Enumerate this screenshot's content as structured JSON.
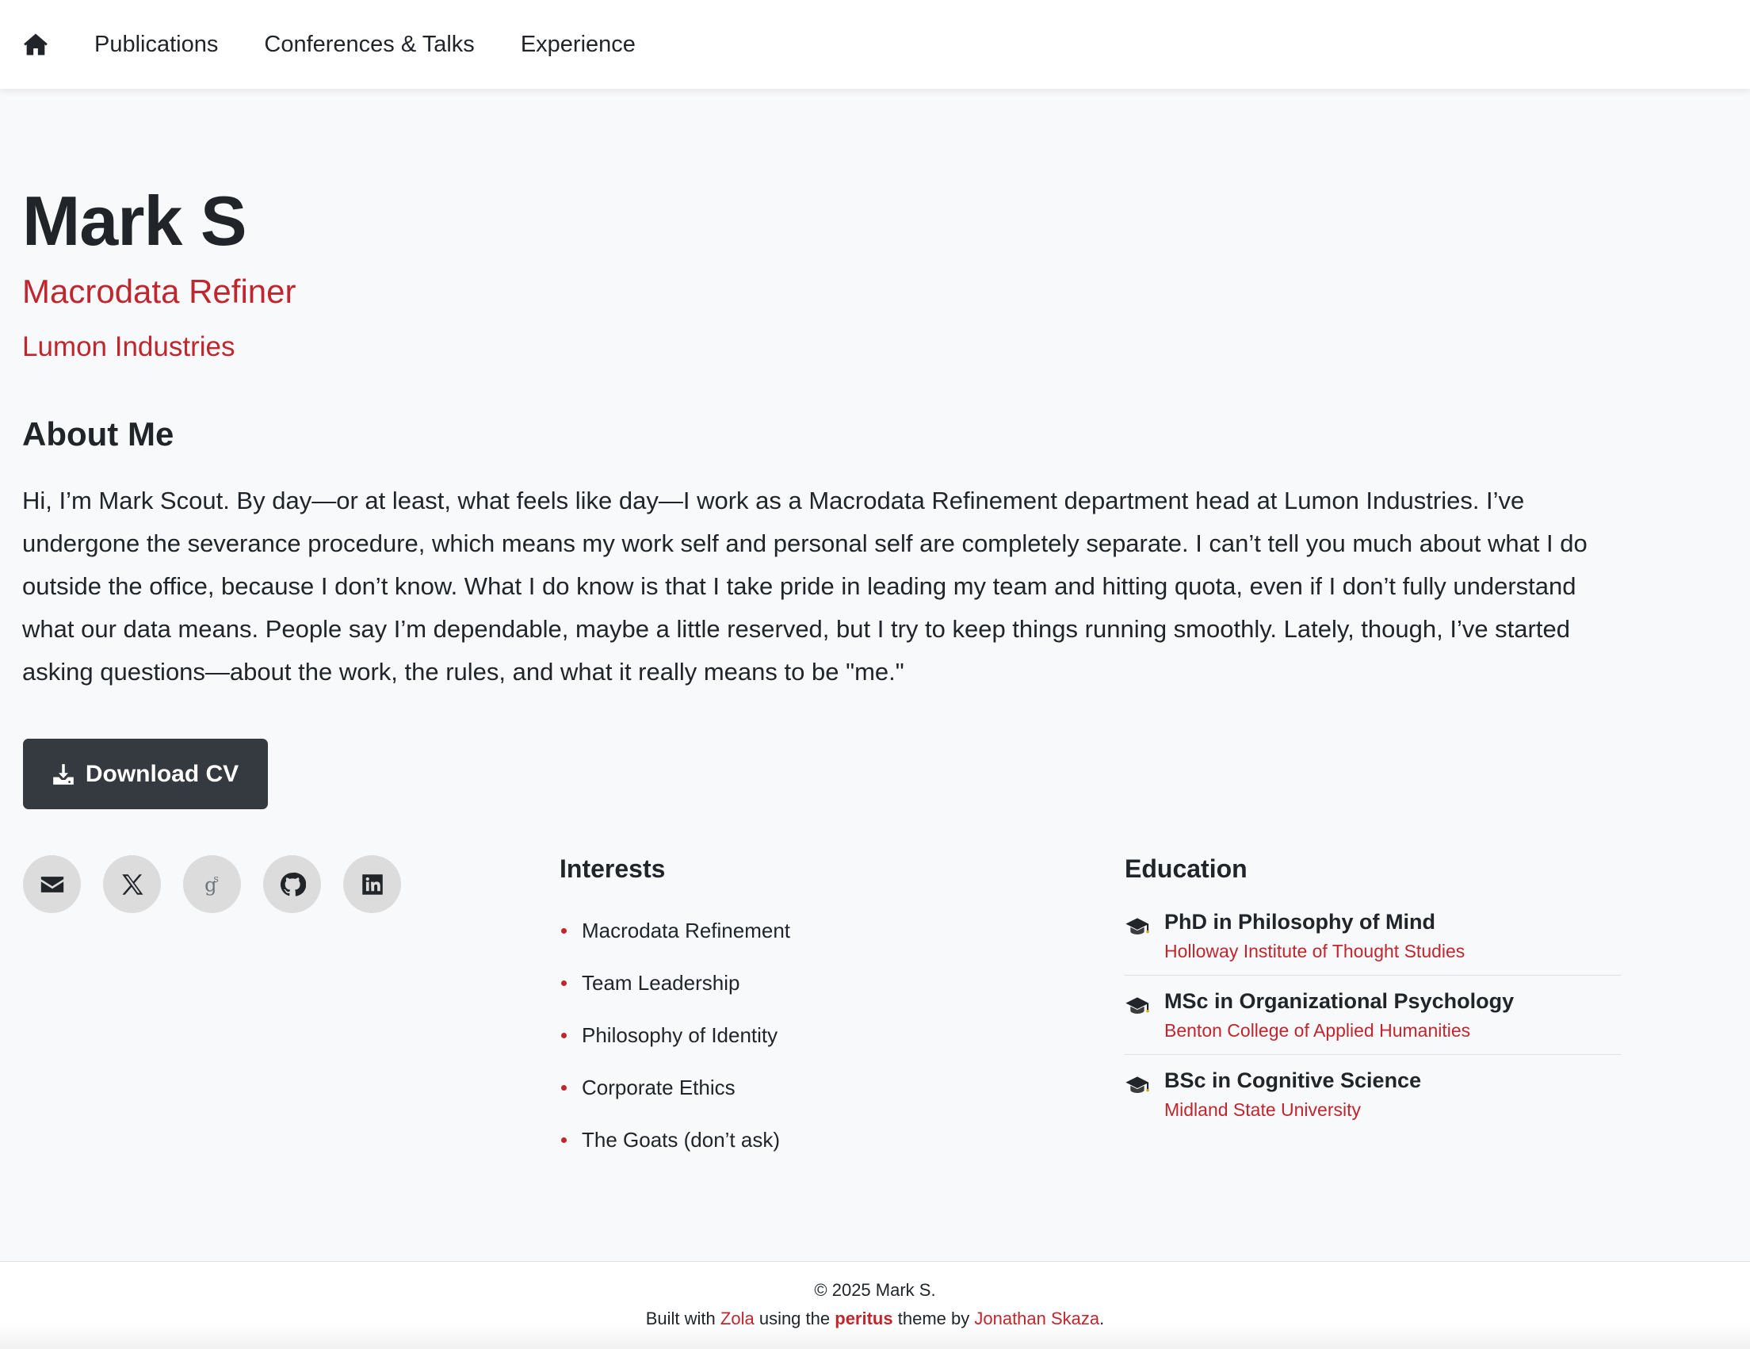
{
  "nav": {
    "home_icon": "home-icon",
    "links": [
      "Publications",
      "Conferences & Talks",
      "Experience"
    ]
  },
  "profile": {
    "name": "Mark S",
    "role": "Macrodata Refiner",
    "organization": "Lumon Industries"
  },
  "about": {
    "heading": "About Me",
    "text": "Hi, I’m Mark Scout. By day—or at least, what feels like day—I work as a Macrodata Refinement department head at Lumon Industries. I’ve undergone the severance procedure, which means my work self and personal self are completely separate. I can’t tell you much about what I do outside the office, because I don’t know. What I do know is that I take pride in leading my team and hitting quota, even if I don’t fully understand what our data means. People say I’m dependable, maybe a little reserved, but I try to keep things running smoothly. Lately, though, I’ve started asking questions—about the work, the rules, and what it really means to be \"me.\""
  },
  "cv_button": {
    "label": "Download CV",
    "icon": "download-icon"
  },
  "social": [
    "email-icon",
    "x-icon",
    "google-scholar-icon",
    "github-icon",
    "linkedin-icon"
  ],
  "interests": {
    "heading": "Interests",
    "items": [
      "Macrodata Refinement",
      "Team Leadership",
      "Philosophy of Identity",
      "Corporate Ethics",
      "The Goats (don’t ask)"
    ]
  },
  "education": {
    "heading": "Education",
    "items": [
      {
        "degree": "PhD in Philosophy of Mind",
        "school": "Holloway Institute of Thought Studies"
      },
      {
        "degree": "MSc in Organizational Psychology",
        "school": "Benton College of Applied Humanities"
      },
      {
        "degree": "BSc in Cognitive Science",
        "school": "Midland State University"
      }
    ]
  },
  "footer": {
    "copyright": "© 2025 Mark S.",
    "built_prefix": "Built with",
    "zola": "Zola",
    "using_the": "using the",
    "theme_name": "peritus",
    "theme_by": "theme by",
    "author": "Jonathan Skaza",
    "end": "."
  },
  "colors": {
    "accent": "#c0262d",
    "dark_button": "#343a40",
    "background": "#f8f9fa"
  }
}
